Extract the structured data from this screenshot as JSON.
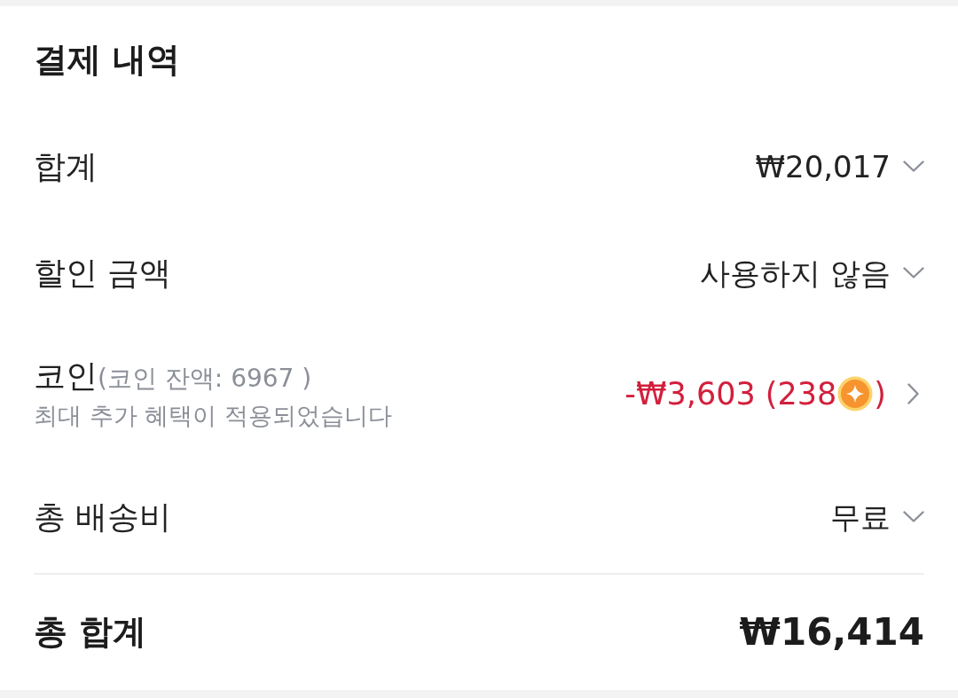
{
  "title": "결제 내역",
  "rows": [
    {
      "kind": "dropdown",
      "label": "합계",
      "value": "₩20,017"
    },
    {
      "kind": "dropdown",
      "label": "할인 금액",
      "value": "사용하지 않음"
    },
    {
      "kind": "coin",
      "label": "코인",
      "note": "(코인 잔액: 6967 )",
      "description": "최대 추가 혜택이 적용되었습니다",
      "value": "-₩3,603 (238",
      "value_end": ")"
    },
    {
      "kind": "dropdown",
      "label": "총 배송비",
      "value": "무료"
    }
  ],
  "total": {
    "label": "총 합계",
    "value": "₩16,414"
  }
}
